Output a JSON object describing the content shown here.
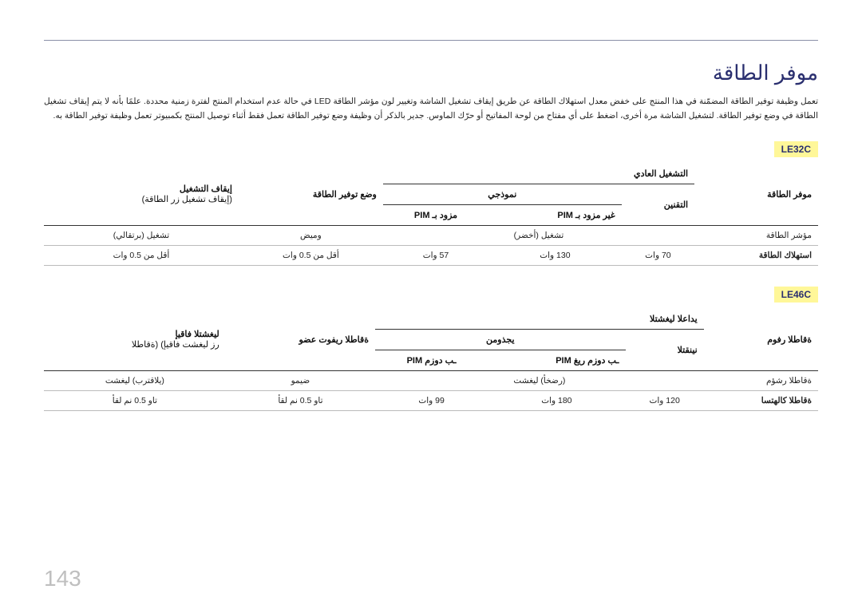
{
  "title": "موفر الطاقة",
  "intro": "تعمل وظيفة توفير الطاقة المضمّنة في هذا المنتج على خفض معدل استهلاك الطاقة عن طريق إيقاف تشغيل الشاشة وتغيير لون مؤشر الطاقة LED في حالة عدم استخدام المنتج لفترة زمنية محددة. علمًا بأنه لا يتم إيقاف تشغيل الطاقة في وضع توفير الطاقة. لتشغيل الشاشة مرة أخرى، اضغط على أي مفتاح من لوحة المفاتيح أو حرّك الماوس. جدير بالذكر أن وظيفة وضع توفير الطاقة تعمل فقط أثناء توصيل المنتج بكمبيوتر تعمل وظيفة توفير الطاقة به.",
  "model1": {
    "label": "LE32C"
  },
  "model2": {
    "label": "LE46C"
  },
  "headers1": {
    "c0": "موفر الطاقة",
    "c1": "التشغيل العادي",
    "c2": "وضع توفير الطاقة",
    "c3": "إيقاف التشغيل",
    "c3sub": "(إيقاف تشغيل زر الطاقة)",
    "sub_c1a": "التقنين",
    "sub_c1b": "نموذجي",
    "sub2_a": "غير مزود بـ PIM",
    "sub2_b": "مزود بـ PIM"
  },
  "t1": {
    "r0": {
      "label": "مؤشر الطاقة",
      "a": "تشغيل (أخضر)",
      "b": "",
      "c": "",
      "d": "وميض",
      "e": "تشغيل (برتقالي)"
    },
    "r1": {
      "label": "استهلاك الطاقة",
      "a": "70 وات",
      "b": "130 وات",
      "c": "57 وات",
      "d": "أقل من 0.5 وات",
      "e": "أقل من 0.5 وات"
    }
  },
  "headers2": {
    "c0": "ةقاطلا رفوم",
    "c1": "يداعلا ليغشتلا",
    "c2": "ةقاطلا ريفوت عضو",
    "c3": "ليغشتلا فاقيإ",
    "c3sub": "رز ليغشت فاقيإ) (ةقاطلا",
    "sub_c1a": "نينقتلا",
    "sub_c1b": "يجذومن",
    "sub2_a": "ـب دوزم ريغ PIM",
    "sub2_b": "ـب دوزم PIM"
  },
  "t2": {
    "r0": {
      "label": "ةقاطلا رشؤم",
      "a": "(رضخأ) ليغشت",
      "b": "",
      "c": "",
      "d": "ضيمو",
      "e": "(يلاقترب) ليغشت"
    },
    "r1": {
      "label": "ةقاطلا كالهتسا",
      "a": "120 وات",
      "b": "180 وات",
      "c": "99 وات",
      "d": "تاو 0.5 نم لقأ",
      "e": "تاو 0.5 نم لقأ"
    }
  },
  "page": "143"
}
